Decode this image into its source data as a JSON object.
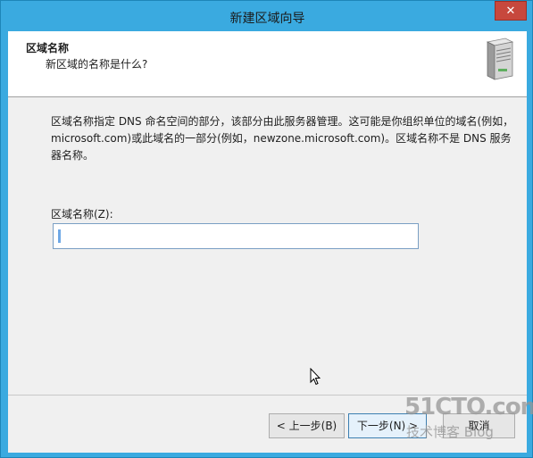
{
  "window": {
    "title": "新建区域向导",
    "close_glyph": "✕"
  },
  "header": {
    "title": "区域名称",
    "subtitle": "新区域的名称是什么?"
  },
  "main": {
    "description": "区域名称指定 DNS 命名空间的部分，该部分由此服务器管理。这可能是你组织单位的域名(例如，microsoft.com)或此域名的一部分(例如，newzone.microsoft.com)。区域名称不是 DNS 服务器名称。",
    "zone_name_label": "区域名称(Z):",
    "zone_name_value": ""
  },
  "buttons": {
    "back": "< 上一步(B)",
    "next": "下一步(N) >",
    "cancel": "取消"
  },
  "watermark": {
    "logo": "51CTO.com",
    "sub": "技术博客 Blog"
  }
}
